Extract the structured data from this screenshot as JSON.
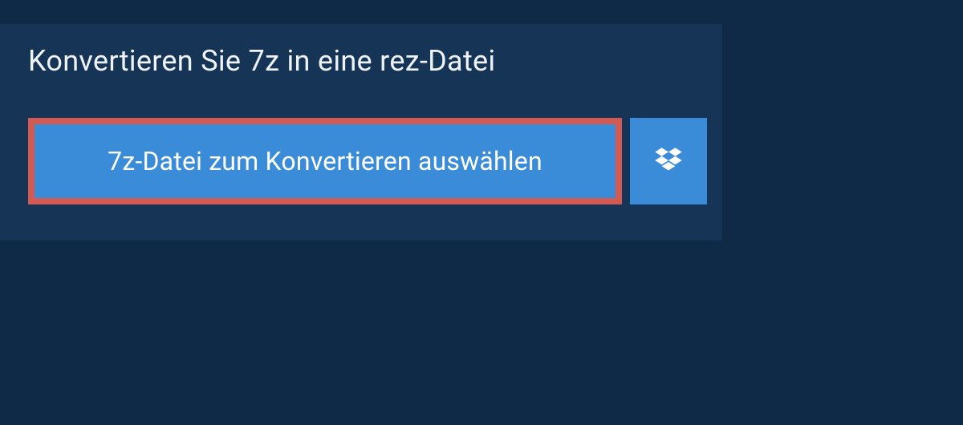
{
  "heading": "Konvertieren Sie 7z in eine rez-Datei",
  "select_button_label": "7z-Datei zum Konvertieren auswählen",
  "colors": {
    "page_bg": "#0e2a47",
    "panel_bg": "#163456",
    "button_bg": "#3a8bd8",
    "highlight_border": "#d25a53",
    "text_light": "#eef3f7",
    "text_white": "#ffffff"
  },
  "icons": {
    "dropbox": "dropbox-icon"
  }
}
